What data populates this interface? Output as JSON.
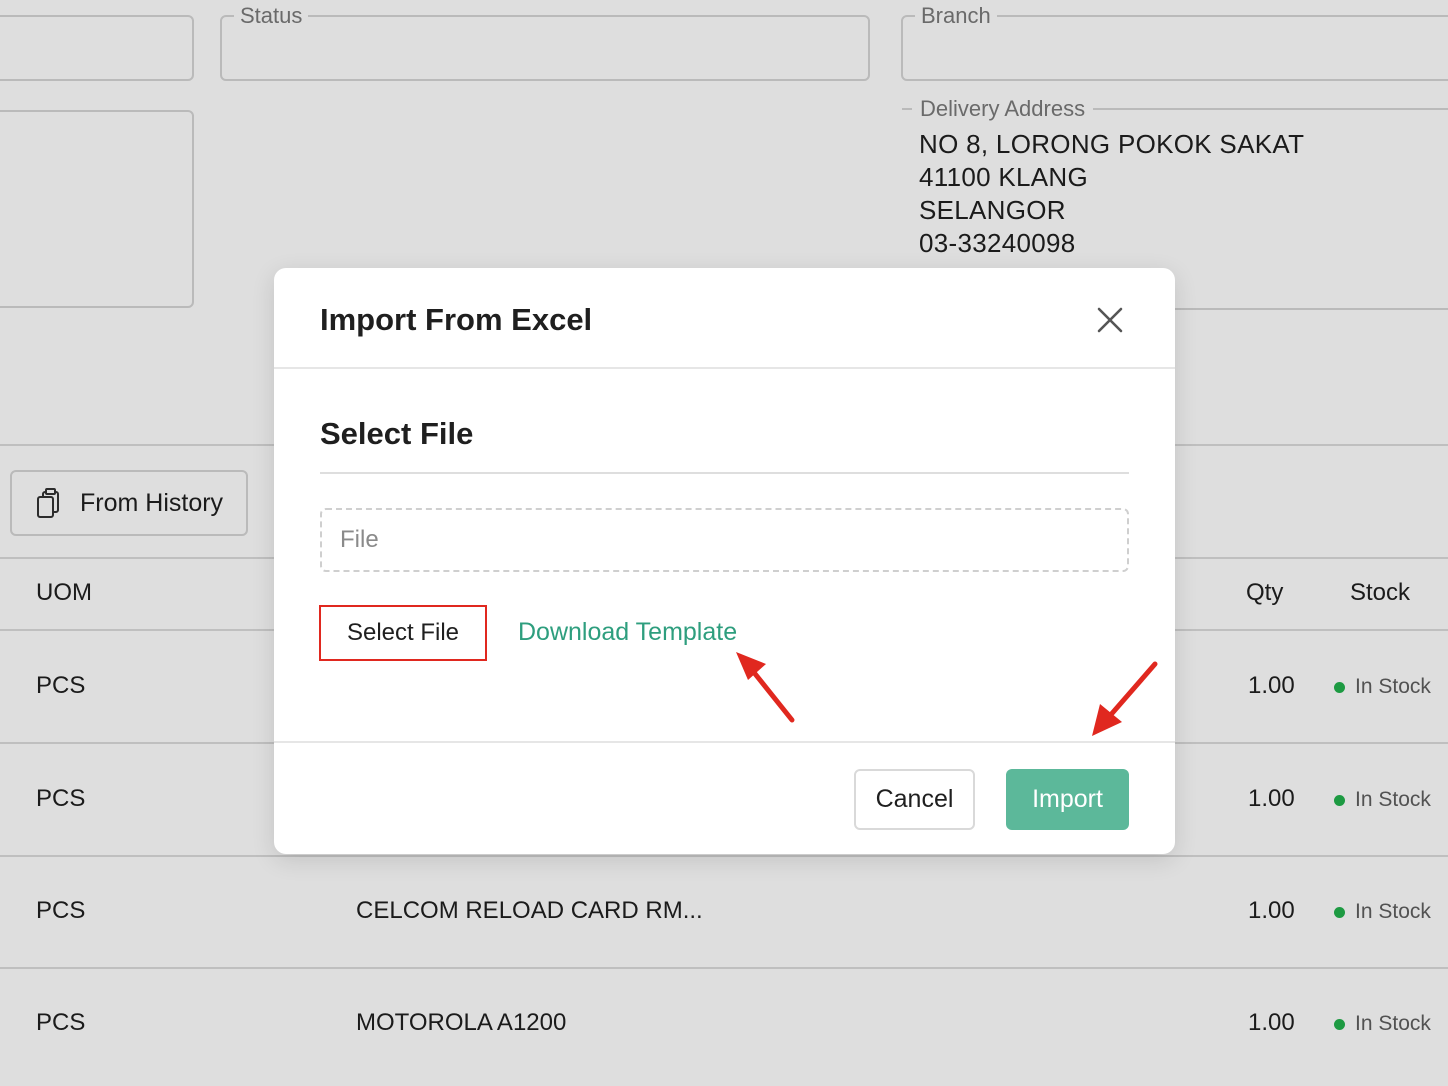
{
  "form": {
    "status_label": "Status",
    "branch_label": "Branch",
    "delivery_address": {
      "label": "Delivery Address",
      "lines": [
        "NO 8, LORONG POKOK SAKAT",
        "41100 KLANG",
        "SELANGOR",
        "03-33240098"
      ]
    }
  },
  "toolbar": {
    "from_history_label": "From History",
    "from_history_icon": "clipboard-copy-icon"
  },
  "table": {
    "columns": {
      "uom": "UOM",
      "qty": "Qty",
      "stock": "Stock"
    },
    "rows": [
      {
        "uom": "PCS",
        "description": "",
        "qty": "1.00",
        "stock": "In Stock"
      },
      {
        "uom": "PCS",
        "description": "",
        "qty": "1.00",
        "stock": "In Stock"
      },
      {
        "uom": "PCS",
        "description": "CELCOM RELOAD CARD RM...",
        "qty": "1.00",
        "stock": "In Stock"
      },
      {
        "uom": "PCS",
        "description": "MOTOROLA A1200",
        "qty": "1.00",
        "stock": "In Stock"
      }
    ]
  },
  "modal": {
    "title": "Import From Excel",
    "close_icon": "close-icon",
    "section_title": "Select File",
    "file_placeholder": "File",
    "select_file_label": "Select File",
    "download_template_label": "Download Template",
    "cancel_label": "Cancel",
    "import_label": "Import"
  },
  "colors": {
    "accent_green": "#2e9e7e",
    "import_button": "#5cb89a",
    "highlight_red": "#e0281f",
    "stock_dot": "#22b14c"
  }
}
